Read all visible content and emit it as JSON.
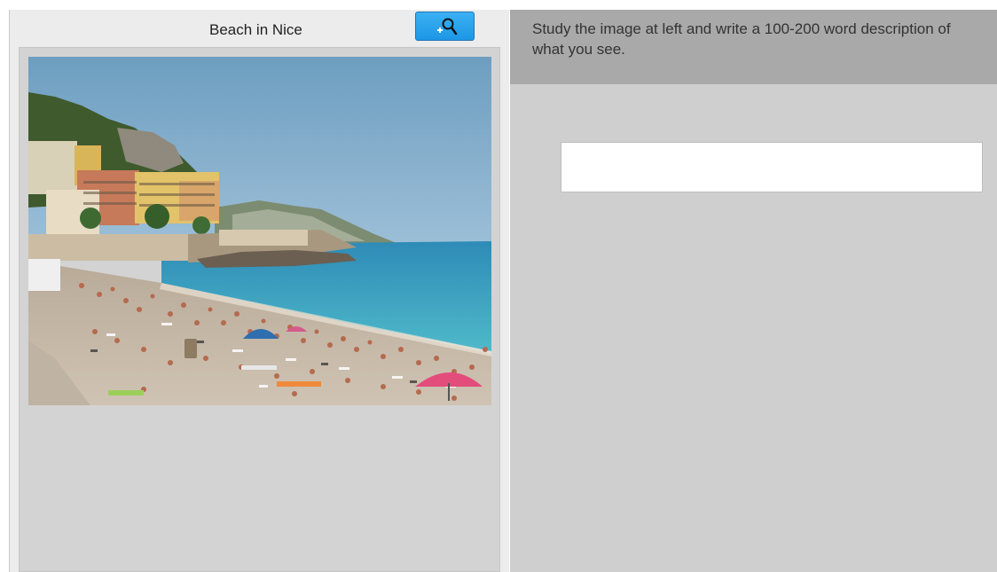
{
  "left_panel": {
    "title": "Beach in Nice",
    "zoom_button": {
      "icon": "zoom-in-icon"
    },
    "photo": {
      "subject": "beach-photo"
    }
  },
  "right_panel": {
    "instruction": "Study the image at left and write a 100-200 word description of what you see.",
    "answer_field": {
      "value": "",
      "placeholder": ""
    }
  },
  "colors": {
    "button_blue": "#29a3ec",
    "instruction_bar": "#a9a9a9",
    "panel_gray": "#cfcfcf"
  }
}
